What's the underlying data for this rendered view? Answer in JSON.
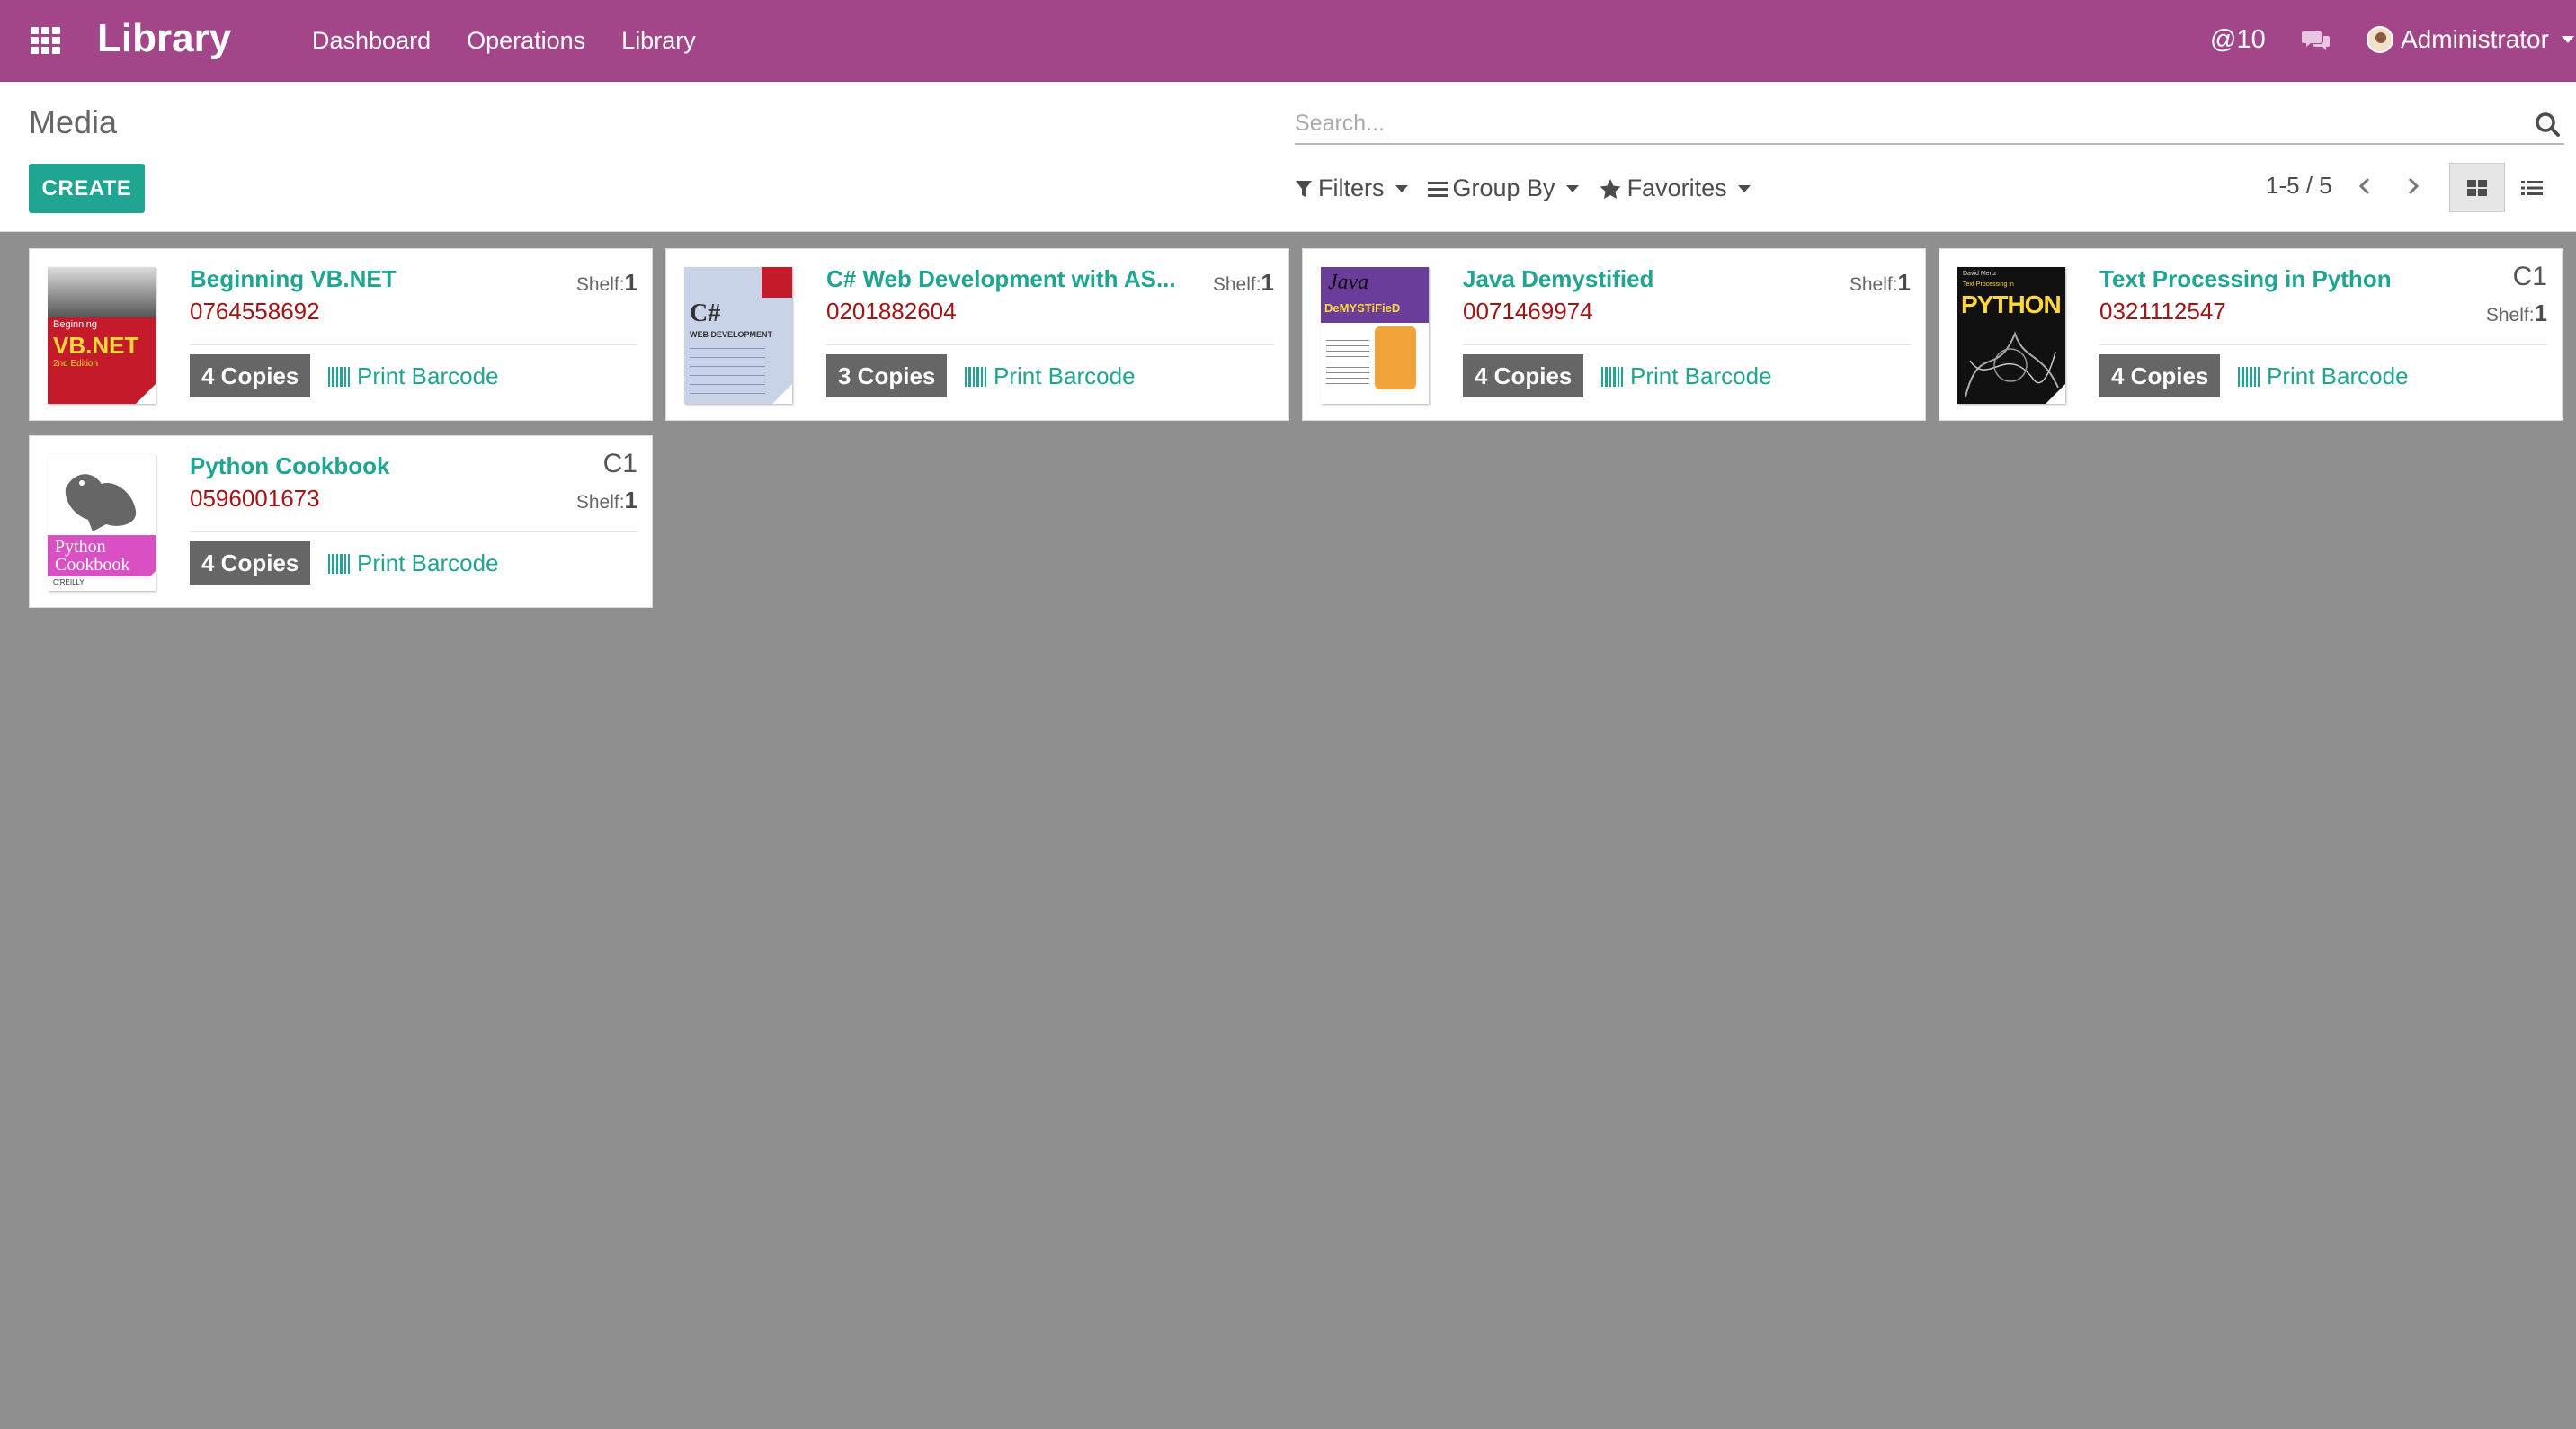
{
  "navbar": {
    "brand": "Library",
    "menu": [
      "Dashboard",
      "Operations",
      "Library"
    ],
    "mentions": "@10",
    "user": "Administrator"
  },
  "control": {
    "breadcrumb": "Media",
    "create_label": "CREATE",
    "search_placeholder": "Search...",
    "filters_label": "Filters",
    "groupby_label": "Group By",
    "favorites_label": "Favorites",
    "pager": "1-5 / 5"
  },
  "colors": {
    "navbar": "#a24689",
    "accent": "#1fa591",
    "isbn": "#a31515",
    "background": "#8f8f8f"
  },
  "books": [
    {
      "title": "Beginning VB.NET",
      "isbn": "0764558692",
      "shelf_label": "Shelf:",
      "shelf": "1",
      "location": "",
      "copies": "4 Copies",
      "barcode_label": "Print Barcode",
      "cover_text": "VB.NET",
      "cover_sub": "Beginning",
      "cover_sub2": "2nd Edition"
    },
    {
      "title": "C# Web Development with AS...",
      "isbn": "0201882604",
      "shelf_label": "Shelf:",
      "shelf": "1",
      "location": "",
      "copies": "3 Copies",
      "barcode_label": "Print Barcode",
      "cover_text": "C#",
      "cover_sub": "WEB DEVELOPMENT",
      "cover_sub2": ""
    },
    {
      "title": "Java Demystified",
      "isbn": "0071469974",
      "shelf_label": "Shelf:",
      "shelf": "1",
      "location": "",
      "copies": "4 Copies",
      "barcode_label": "Print Barcode",
      "cover_text": "Java",
      "cover_sub": "DeMYSTiFieD",
      "cover_sub2": ""
    },
    {
      "title": "Text Processing in Python",
      "isbn": "0321112547",
      "shelf_label": "Shelf:",
      "shelf": "1",
      "location": "C1",
      "copies": "4 Copies",
      "barcode_label": "Print Barcode",
      "cover_text": "PYTHON",
      "cover_sub": "Text Processing in",
      "cover_sub2": "David Mertz"
    },
    {
      "title": "Python Cookbook",
      "isbn": "0596001673",
      "shelf_label": "Shelf:",
      "shelf": "1",
      "location": "C1",
      "copies": "4 Copies",
      "barcode_label": "Print Barcode",
      "cover_text": "Python",
      "cover_sub": "Cookbook",
      "cover_sub2": "O'REILLY"
    }
  ]
}
